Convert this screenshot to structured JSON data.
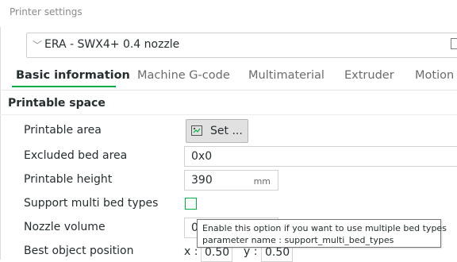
{
  "window": {
    "title": "Printer settings"
  },
  "preset": {
    "value": "ERA - SWX4+ 0.4 nozzle",
    "chevron_icon": "chevron-down-icon"
  },
  "tabs": [
    {
      "label": "Basic information",
      "active": true
    },
    {
      "label": "Machine G-code",
      "active": false
    },
    {
      "label": "Multimaterial",
      "active": false
    },
    {
      "label": "Extruder",
      "active": false
    },
    {
      "label": "Motion",
      "active": false
    }
  ],
  "section": {
    "title": "Printable space"
  },
  "fields": {
    "printable_area": {
      "label": "Printable area",
      "button_label": "Set ...",
      "icon": "bed-shape-icon"
    },
    "excluded_bed_area": {
      "label": "Excluded bed area",
      "value": "0x0"
    },
    "printable_height": {
      "label": "Printable height",
      "value": "390",
      "unit": "mm"
    },
    "support_multi_bed_types": {
      "label": "Support multi bed types",
      "checked": false
    },
    "nozzle_volume": {
      "label": "Nozzle volume",
      "value": "0"
    },
    "best_object_position": {
      "label": "Best object position",
      "x_label": "x :",
      "x_value": "0.50",
      "y_label": "y :",
      "y_value": "0.50"
    }
  },
  "tooltip": {
    "line1": "Enable this option if you want to use multiple bed types",
    "line2": "parameter name   : support_multi_bed_types"
  },
  "colors": {
    "accent": "#00ae42",
    "text": "#262e30",
    "muted": "#6b6b6b"
  }
}
